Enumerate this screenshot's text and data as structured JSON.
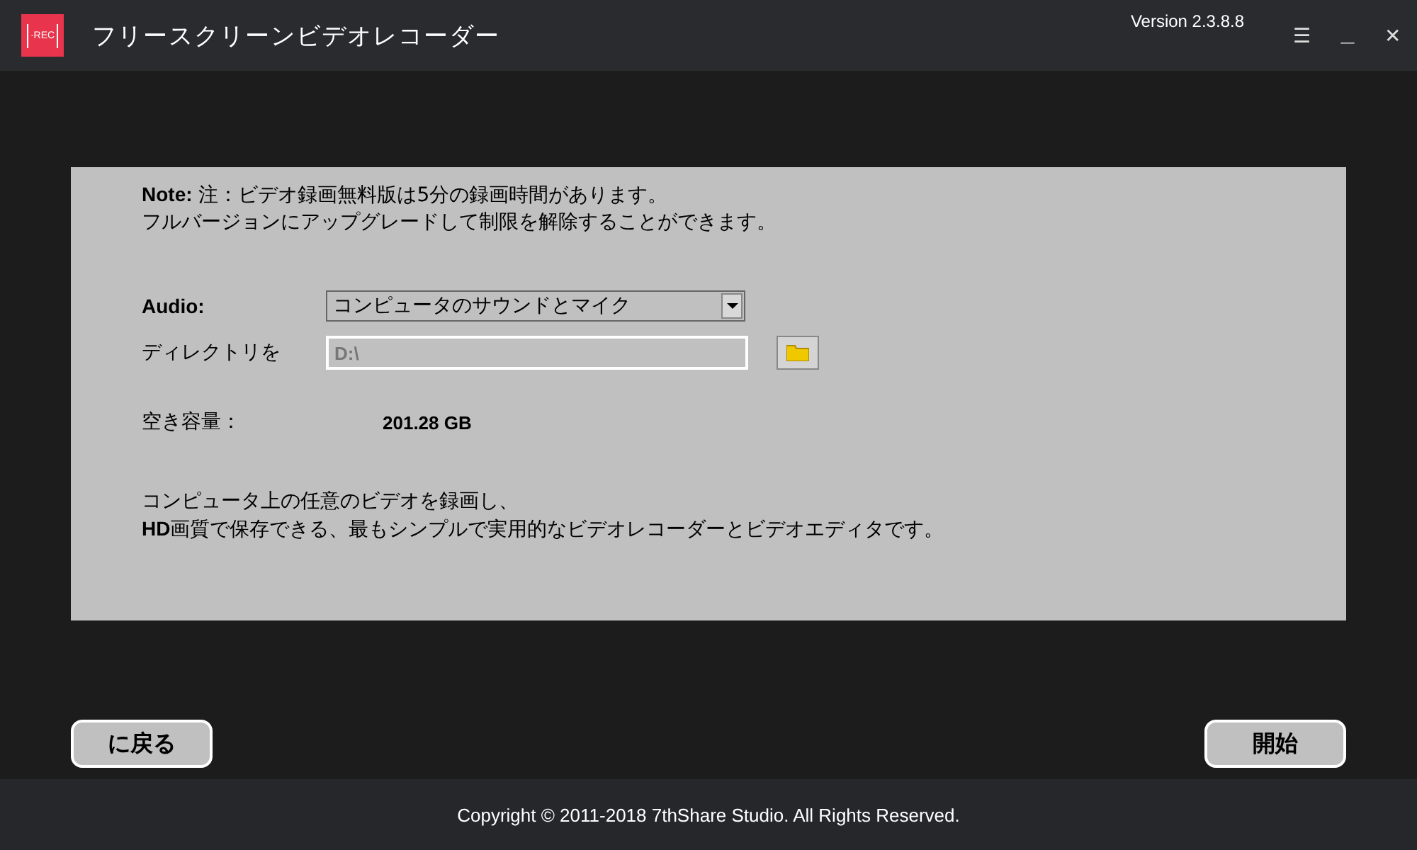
{
  "window": {
    "logo": "·REC",
    "title": "フリースクリーンビデオレコーダー",
    "version": "Version 2.3.8.8",
    "controls": [
      "☰",
      "＿",
      "✕"
    ]
  },
  "note": [
    "**Note:** 注：ビデオ録画無料版は5分の録画時間があります。",
    "フルバージョンにアップグレードして制限を解除することができます。"
  ],
  "audio": {
    "label": "Audio:",
    "value": "コンピュータのサウンドとマイク"
  },
  "directory": {
    "label": "ディレクトリを",
    "value": "D:\\",
    "disabled": true
  },
  "free_space": {
    "label": "空き容量：",
    "value": "201.28 GB"
  },
  "description": [
    "コンピュータ上の任意のビデオを録画し、",
    "**HD**画質で保存できる、最もシンプルで実用的なビデオレコーダーとビデオエディタです。"
  ],
  "buttons": [
    "に戻る",
    "開始"
  ],
  "status_bar": "Copyright © 2011-2018 7thShare Studio. All Rights Reserved."
}
